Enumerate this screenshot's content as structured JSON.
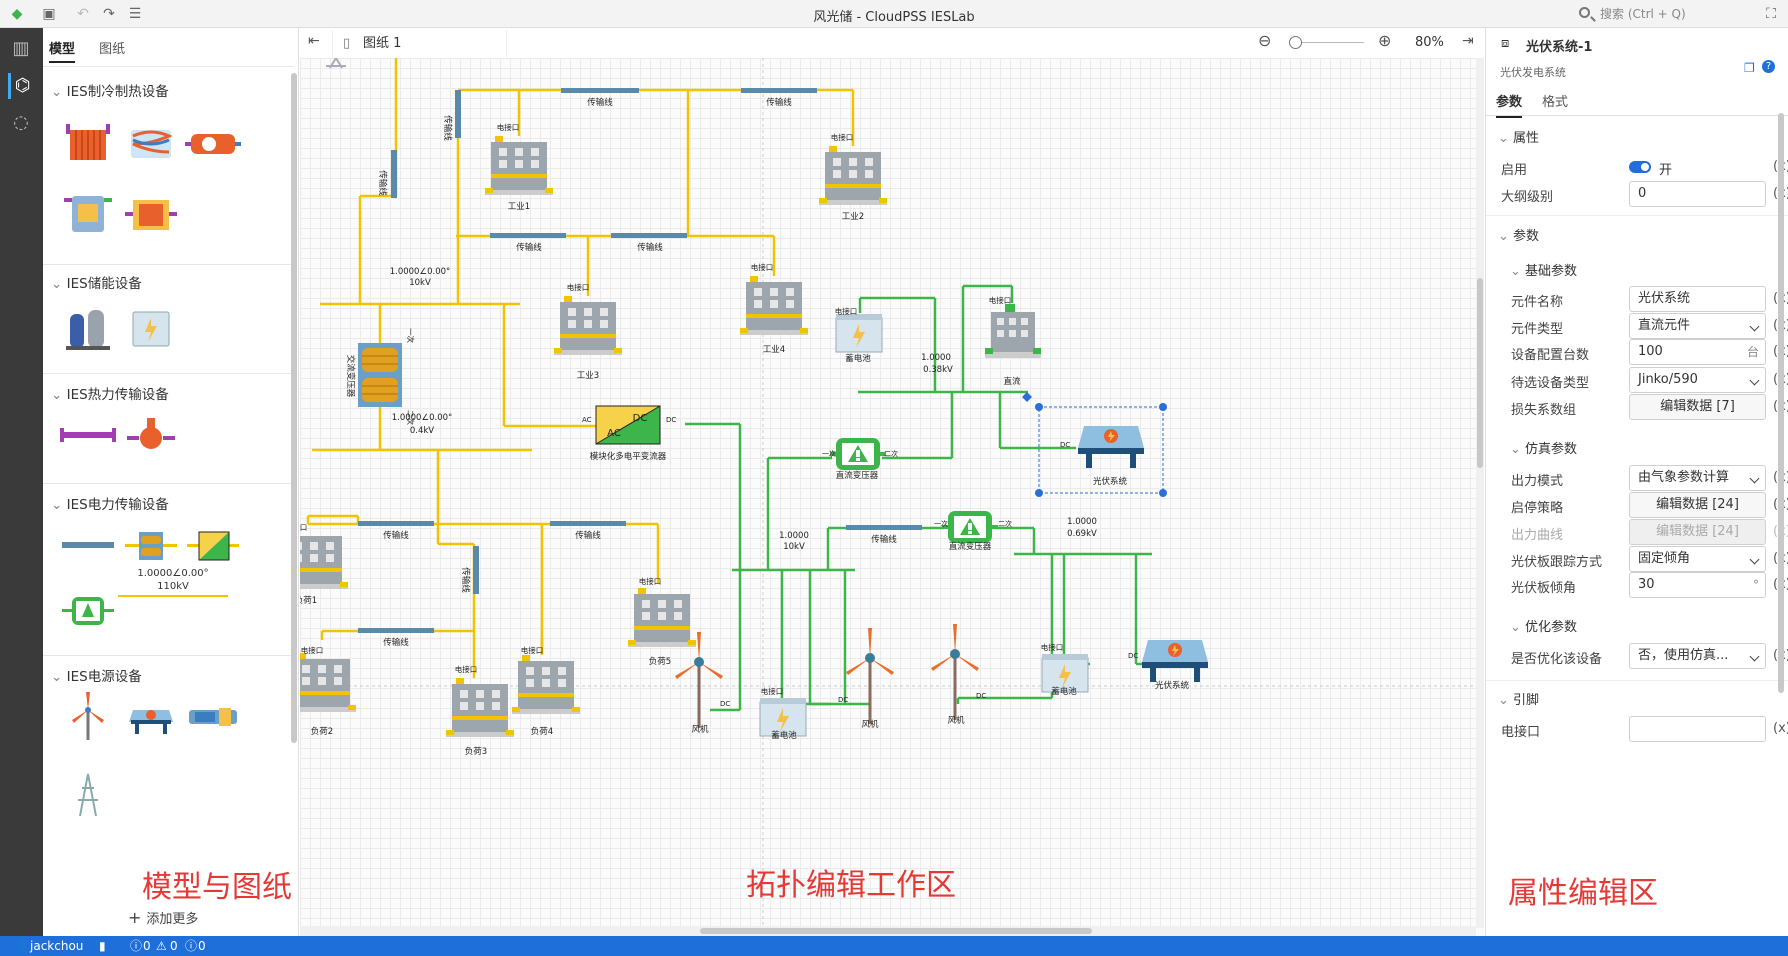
{
  "window": {
    "title": "风光储 - CloudPSS IESLab",
    "search_placeholder": "搜索 (Ctrl + Q)"
  },
  "model_panel": {
    "tabs": [
      "模型",
      "图纸"
    ],
    "categories": [
      "IES制冷制热设备",
      "IES储能设备",
      "IES热力传输设备",
      "IES电力传输设备",
      "IES电源设备"
    ],
    "bus_label_value": "1.0000∠0.00°",
    "bus_label_kv": "110kV",
    "add_more": "添加更多"
  },
  "canvas": {
    "sheet_tab": "图纸 1",
    "zoom": "80%",
    "labels": {
      "transmission_line": "传输线",
      "port": "电接口",
      "industry1": "工业1",
      "industry2": "工业2",
      "industry3": "工业3",
      "industry4": "工业4",
      "bus_10kv_v": "1.0000∠0.00°",
      "bus_10kv": "10kV",
      "bus_04kv_v": "1.0000∠0.00°",
      "bus_04kv": "0.4kV",
      "ac_transformer": "交流变压器",
      "converter": "模块化多电平变流器",
      "ac": "AC",
      "dc": "DC",
      "battery": "蓄电池",
      "dc_load": "直流",
      "dc_bus1_v": "1.0000",
      "dc_bus1_kv": "0.38kV",
      "dc_bus2_v": "1.0000",
      "dc_bus2_kv": "10kV",
      "dc_bus3_v": "1.0000",
      "dc_bus3_kv": "0.69kV",
      "dc_transformer": "直流变压器",
      "primary": "一次",
      "secondary": "二次",
      "pv": "光伏系统",
      "load1": "负荷1",
      "load2": "负荷2",
      "load3": "负荷3",
      "load4": "负荷4",
      "load5": "负荷5",
      "wind": "风机"
    }
  },
  "props": {
    "title": "光伏系统-1",
    "subtitle": "光伏发电系统",
    "tabs": [
      "参数",
      "格式"
    ],
    "sections": {
      "attr": "属性",
      "params": "参数",
      "basic": "基础参数",
      "sim": "仿真参数",
      "opt": "优化参数",
      "pins": "引脚"
    },
    "enable_label": "启用",
    "enable_value": "开",
    "outline_label": "大纲级别",
    "outline_value": "0",
    "name_label": "元件名称",
    "name_value": "光伏系统",
    "type_label": "元件类型",
    "type_value": "直流元件",
    "count_label": "设备配置台数",
    "count_value": "100",
    "count_unit": "台",
    "dev_label": "待选设备类型",
    "dev_value": "Jinko/590",
    "loss_label": "损失系数组",
    "loss_value": "编辑数据 [7]",
    "out_mode_label": "出力模式",
    "out_mode_value": "由气象参数计算",
    "startstop_label": "启停策略",
    "startstop_value": "编辑数据 [24]",
    "curve_label": "出力曲线",
    "curve_value": "编辑数据 [24]",
    "track_label": "光伏板跟踪方式",
    "track_value": "固定倾角",
    "tilt_label": "光伏板倾角",
    "tilt_value": "30",
    "tilt_unit": "°",
    "optimize_label": "是否优化该设备",
    "optimize_value": "否，使用仿真...",
    "pin_label": "电接口",
    "pin_value": "",
    "x": "(x)"
  },
  "annotations": {
    "left": "模型与图纸",
    "center": "拓扑编辑工作区",
    "right": "属性编辑区"
  },
  "status": {
    "user": "jackchou",
    "errors": "0",
    "warnings": "0",
    "infos": "0"
  },
  "colors": {
    "ac_line": "#f2c400",
    "dc_line": "#3cb54a",
    "cable": "#5a8aa8",
    "accent": "#1e6fd9"
  }
}
